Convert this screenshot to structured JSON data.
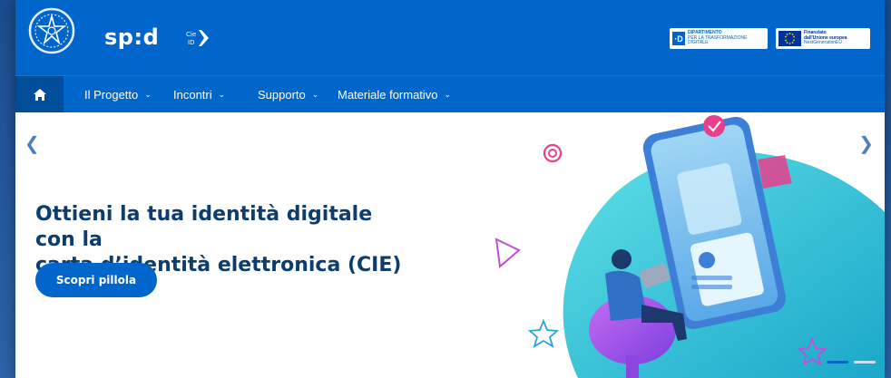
{
  "header": {
    "brand": "sp:d",
    "cie_badge": "Cie ID",
    "partner_dtd": {
      "mark": "·D",
      "line1": "DIPARTIMENTO",
      "line2": "PER LA TRASFORMAZIONE",
      "line3": "DIGITALE"
    },
    "partner_eu": {
      "line1": "Finanziato",
      "line2": "dall'Unione europea",
      "line3": "NextGenerationEU"
    }
  },
  "nav": {
    "items": [
      {
        "label": "Il Progetto"
      },
      {
        "label": "Incontri"
      },
      {
        "label": "Supporto"
      },
      {
        "label": "Materiale formativo"
      }
    ]
  },
  "hero": {
    "title_line1": "Ottieni la tua identità digitale con la",
    "title_line2": "carta d’identità elettronica (CIE)",
    "cta_label": "Scopri pillola"
  },
  "colors": {
    "primary": "#0066cc",
    "title": "#0b3d6e",
    "accent_cyan": "#26c6da",
    "accent_pink": "#e83e8c"
  }
}
